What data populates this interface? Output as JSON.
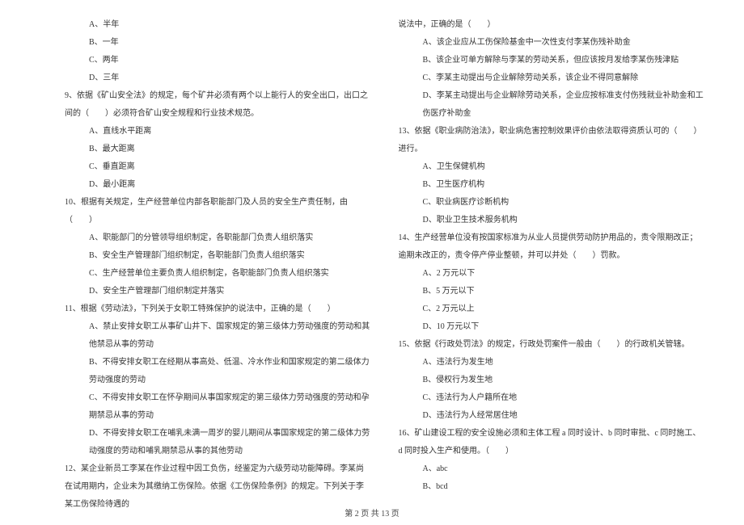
{
  "left": {
    "q8_opts": {
      "a": "A、半年",
      "b": "B、一年",
      "c": "C、两年",
      "d": "D、三年"
    },
    "q9": "9、依据《矿山安全法》的规定，每个矿井必须有两个以上能行人的安全出口，出口之间的（　　）必须符合矿山安全规程和行业技术规范。",
    "q9_opts": {
      "a": "A、直线水平距离",
      "b": "B、最大距离",
      "c": "C、垂直距离",
      "d": "D、最小距离"
    },
    "q10": "10、根据有关规定，生产经营单位内部各职能部门及人员的安全生产责任制，由（　　）",
    "q10_opts": {
      "a": "A、职能部门的分管领导组织制定，各职能部门负责人组织落实",
      "b": "B、安全生产管理部门组织制定，各职能部门负责人组织落实",
      "c": "C、生产经营单位主要负责人组织制定，各职能部门负责人组织落实",
      "d": "D、安全生产管理部门组织制定并落实"
    },
    "q11": "11、根据《劳动法》，下列关于女职工特殊保护的说法中，正确的是（　　）",
    "q11_opts": {
      "a": "A、禁止安排女职工从事矿山井下、国家规定的第三级体力劳动强度的劳动和其他禁忌从事的劳动",
      "b": "B、不得安排女职工在经期从事高处、低温、冷水作业和国家规定的第二级体力劳动强度的劳动",
      "c": "C、不得安排女职工在怀孕期间从事国家规定的第三级体力劳动强度的劳动和孕期禁忌从事的劳动",
      "d": "D、不得安排女职工在哺乳未满一周岁的婴儿期间从事国家规定的第二级体力劳动强度的劳动和哺乳期禁忌从事的其他劳动"
    },
    "q12": "12、某企业新员工李某在作业过程中因工负伤，经鉴定为六级劳动功能障碍。李某尚在试用期内，企业未为其缴纳工伤保险。依据《工伤保险条例》的规定。下列关于李某工伤保险待遇的"
  },
  "right": {
    "q12_cont": "说法中，正确的是（　　）",
    "q12_opts": {
      "a": "A、该企业应从工伤保险基金中一次性支付李某伤残补助金",
      "b": "B、该企业可单方解除与李某的劳动关系，但应该按月发给李某伤残津贴",
      "c": "C、李某主动提出与企业解除劳动关系，该企业不得同意解除",
      "d": "D、李某主动提出与企业解除劳动关系，企业应按标准支付伤残就业补助金和工伤医疗补助金"
    },
    "q13": "13、依据《职业病防治法》，职业病危害控制效果评价由依法取得资质认可的（　　）进行。",
    "q13_opts": {
      "a": "A、卫生保健机构",
      "b": "B、卫生医疗机构",
      "c": "C、职业病医疗诊断机构",
      "d": "D、职业卫生技术服务机构"
    },
    "q14": "14、生产经营单位没有按国家标准为从业人员提供劳动防护用品的，责令限期改正；逾期未改正的，责令停产停业整顿，并可以并处（　　）罚款。",
    "q14_opts": {
      "a": "A、2 万元以下",
      "b": "B、5 万元以下",
      "c": "C、2 万元以上",
      "d": "D、10 万元以下"
    },
    "q15": "15、依据《行政处罚法》的规定，行政处罚案件一般由（　　）的行政机关管辖。",
    "q15_opts": {
      "a": "A、违法行为发生地",
      "b": "B、侵权行为发生地",
      "c": "C、违法行为人户籍所在地",
      "d": "D、违法行为人经常居住地"
    },
    "q16": "16、矿山建设工程的安全设施必须和主体工程 a 同时设计、b 同时审批、c 同时施工、d 同时投入生产和使用。（　　）",
    "q16_opts": {
      "a": "A、abc",
      "b": "B、bcd"
    }
  },
  "footer": "第 2 页 共 13 页"
}
